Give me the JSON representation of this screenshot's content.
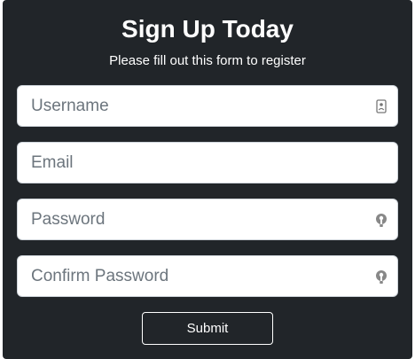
{
  "form": {
    "title": "Sign Up Today",
    "subtitle": "Please fill out this form to register",
    "fields": [
      {
        "placeholder": "Username",
        "value": "",
        "icon": "contact-card-icon"
      },
      {
        "placeholder": "Email",
        "value": ""
      },
      {
        "placeholder": "Password",
        "value": "",
        "icon": "password-key-icon"
      },
      {
        "placeholder": "Confirm Password",
        "value": "",
        "icon": "password-key-icon"
      }
    ],
    "submit_label": "Submit"
  },
  "colors": {
    "panel_background": "#212529",
    "field_background": "#ffffff",
    "placeholder_text": "#6c757d",
    "text_light": "#ffffff"
  }
}
